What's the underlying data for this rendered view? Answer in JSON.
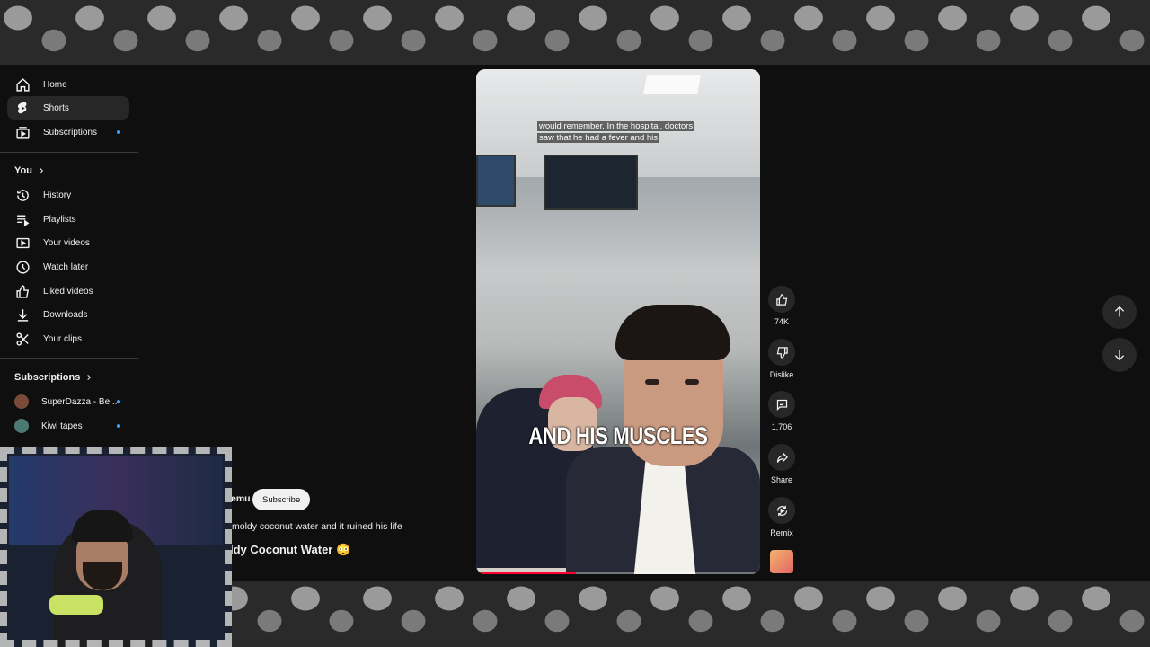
{
  "sidebar": {
    "main": [
      {
        "label": "Home",
        "icon": "home-icon"
      },
      {
        "label": "Shorts",
        "icon": "shorts-icon",
        "active": true
      },
      {
        "label": "Subscriptions",
        "icon": "subscriptions-icon",
        "dot": true
      }
    ],
    "you_heading": "You",
    "you": [
      {
        "label": "History",
        "icon": "history-icon"
      },
      {
        "label": "Playlists",
        "icon": "playlists-icon"
      },
      {
        "label": "Your videos",
        "icon": "your-videos-icon"
      },
      {
        "label": "Watch later",
        "icon": "watch-later-icon"
      },
      {
        "label": "Liked videos",
        "icon": "liked-videos-icon"
      },
      {
        "label": "Downloads",
        "icon": "downloads-icon"
      },
      {
        "label": "Your clips",
        "icon": "clips-icon"
      }
    ],
    "subs_heading": "Subscriptions",
    "subs": [
      {
        "label": "SuperDazza - Be...",
        "avatar_color": "#7a4b3a",
        "dot": true
      },
      {
        "label": "Kiwi tapes",
        "avatar_color": "#4a7a72",
        "dot": true
      }
    ]
  },
  "video": {
    "caption_top_line1": "would remember. In the hospital, doctors",
    "caption_top_line2": "saw that he had a fever and his",
    "caption_big": "AND HIS MUSCLES",
    "progress": 0.35
  },
  "actions": {
    "like_count": "74K",
    "dislike_label": "Dislike",
    "comment_count": "1,706",
    "share_label": "Share",
    "remix_label": "Remix"
  },
  "meta": {
    "channel_partial": "emu",
    "subscribe_label": "Subscribe",
    "description_partial": "moldy coconut water and it ruined his life",
    "title_partial": "ldy Coconut Water 😳"
  },
  "colors": {
    "accent": "#ff0033",
    "bg": "#0f0f0f",
    "button_bg": "#272727",
    "notification_dot": "#3ea6ff"
  }
}
